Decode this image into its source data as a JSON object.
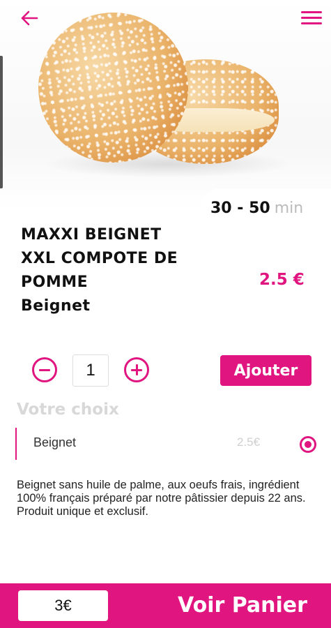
{
  "header": {
    "back_icon": "arrow-left-icon",
    "menu_icon": "hamburger-menu-icon",
    "accent_color": "#e0157f"
  },
  "product": {
    "image_alt": "beignet",
    "delivery_time": "30 - 50",
    "delivery_unit": "min",
    "title": "MAXXI BEIGNET XXL COMPOTE DE POMME",
    "category": "Beignet",
    "price": "2.5 €"
  },
  "quantity": {
    "value": "1",
    "minus_icon": "minus-circle-icon",
    "plus_icon": "plus-circle-icon"
  },
  "add_button": {
    "label": "Ajouter"
  },
  "choice": {
    "title": "Votre choix",
    "options": [
      {
        "label": "Beignet",
        "price": "2.5€",
        "selected": true
      }
    ]
  },
  "description": "Beignet sans huile de palme, aux oeufs frais, ingrédient 100% français préparé par notre pâtissier depuis 22 ans. Produit unique et exclusif.",
  "footer": {
    "total": "3€",
    "cart_label": "Voir Panier"
  }
}
